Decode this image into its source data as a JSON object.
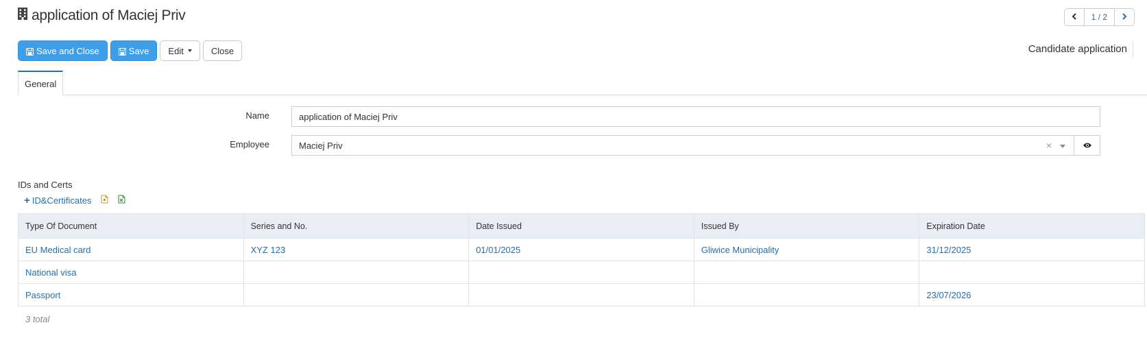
{
  "header": {
    "title": "application of Maciej Priv",
    "pager": "1 / 2",
    "form_type": "Candidate application"
  },
  "toolbar": {
    "save_close_label": "Save and Close",
    "save_label": "Save",
    "edit_label": "Edit",
    "close_label": "Close"
  },
  "tabs": [
    {
      "label": "General"
    }
  ],
  "form": {
    "name_label": "Name",
    "name_value": "application of Maciej Priv",
    "employee_label": "Employee",
    "employee_value": "Maciej Priv"
  },
  "ids_section": {
    "title": "IDs and Certs",
    "add_label": "ID&Certificates",
    "columns": [
      "Type Of Document",
      "Series and No.",
      "Date Issued",
      "Issued By",
      "Expiration Date"
    ],
    "rows": [
      [
        "EU Medical card",
        "XYZ 123",
        "01/01/2025",
        "Gliwice Municipality",
        "31/12/2025"
      ],
      [
        "National visa",
        "",
        "",
        "",
        ""
      ],
      [
        "Passport",
        "",
        "",
        "",
        "23/07/2026"
      ]
    ],
    "total": "3 total"
  },
  "colors": {
    "primary": "#3e9ee8",
    "link": "#2a6ea6",
    "header_bg": "#e9edf5"
  }
}
